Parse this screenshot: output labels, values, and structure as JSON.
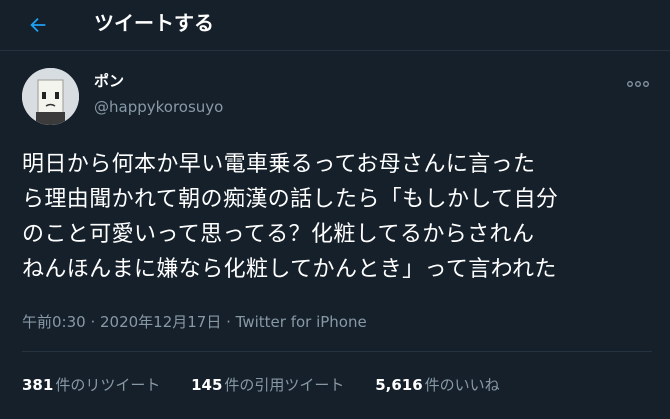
{
  "header": {
    "title": "ツイートする"
  },
  "colors": {
    "background": "#15202b",
    "accent": "#1da1f2",
    "secondary_text": "#8899a6",
    "border": "#253341"
  },
  "tweet": {
    "display_name": "ポン",
    "handle": "@happykorosuyo",
    "text_lines": [
      "明日から何本か早い電車乗るってお母さんに言った",
      "ら理由聞かれて朝の痴漢の話したら「もしかして自分",
      "のこと可愛いって思ってる？化粧してるからされん",
      "ねんほんまに嫌なら化粧してかんとき」って言われた"
    ],
    "timestamp": "午前0:30 · 2020年12月17日",
    "separator": " · ",
    "client": "Twitter for iPhone"
  },
  "stats": {
    "retweets": {
      "count": "381",
      "label": "件のリツイート"
    },
    "quotes": {
      "count": "145",
      "label": "件の引用ツイート"
    },
    "likes": {
      "count": "5,616",
      "label": "件のいいね"
    }
  },
  "icons": {
    "back": "arrow-left-icon",
    "more": "more-horizontal-icon"
  }
}
